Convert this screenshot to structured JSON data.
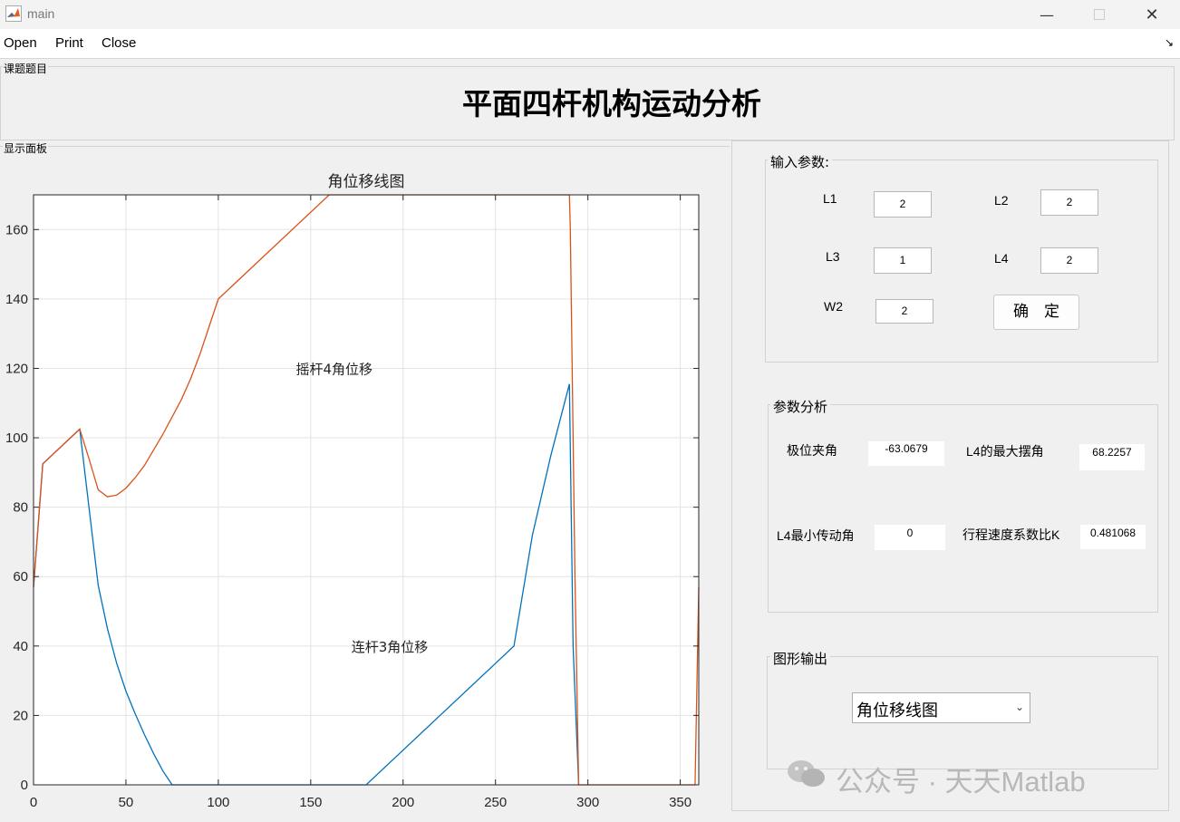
{
  "window": {
    "title": "main"
  },
  "menu": {
    "items": [
      "Open",
      "Print",
      "Close"
    ]
  },
  "title_panel": {
    "label": "课题题目",
    "heading": "平面四杆机构运动分析"
  },
  "display_panel": {
    "label": "显示面板"
  },
  "input_panel": {
    "label": "输入参数:",
    "fields": [
      {
        "label": "L1",
        "value": "2"
      },
      {
        "label": "L2",
        "value": "2"
      },
      {
        "label": "L3",
        "value": "1"
      },
      {
        "label": "L4",
        "value": "2"
      },
      {
        "label": "W2",
        "value": "2"
      }
    ],
    "confirm_label": "确　定"
  },
  "analysis_panel": {
    "label": "参数分析",
    "items": [
      {
        "label": "极位夹角",
        "value": "-63.0679"
      },
      {
        "label": "L4的最大摆角",
        "value": "68.2257"
      },
      {
        "label": "L4最小传动角",
        "value": "0"
      },
      {
        "label": "行程速度系数比K",
        "value": "0.481068"
      }
    ]
  },
  "output_panel": {
    "label": "图形输出",
    "select_value": "角位移线图"
  },
  "watermark": "公众号 · 天天Matlab",
  "chart_data": {
    "type": "line",
    "title": "角位移线图",
    "xlim": [
      0,
      360
    ],
    "ylim": [
      0,
      170
    ],
    "xticks": [
      0,
      50,
      100,
      150,
      200,
      250,
      300,
      350
    ],
    "yticks": [
      0,
      20,
      40,
      60,
      80,
      100,
      120,
      140,
      160
    ],
    "grid": true,
    "annotations": [
      {
        "text": "摇杆4角位移",
        "x": 142,
        "y": 120
      },
      {
        "text": "连杆3角位移",
        "x": 172,
        "y": 40
      }
    ],
    "series": [
      {
        "color": "#0072bd",
        "x": [
          0,
          5,
          25,
          30,
          35,
          40,
          45,
          50,
          55,
          60,
          65,
          70,
          75,
          180,
          260,
          270,
          280,
          290,
          292,
          295
        ],
        "y": [
          57,
          92.5,
          102.5,
          80,
          57.5,
          45,
          35,
          27,
          20.5,
          14.5,
          9,
          4,
          0,
          0,
          40,
          72,
          95,
          115.5,
          40,
          0
        ]
      },
      {
        "color": "#d95319",
        "x": [
          0,
          5,
          25,
          30,
          35,
          40,
          45,
          50,
          55,
          60,
          65,
          70,
          75,
          80,
          85,
          90,
          95,
          100,
          160,
          290,
          290.5,
          293,
          295,
          358,
          360
        ],
        "y": [
          57,
          92.5,
          102.5,
          94,
          85,
          83,
          83.5,
          85.5,
          88.5,
          92,
          96.5,
          101,
          106,
          111,
          117,
          124,
          132,
          140,
          170,
          170,
          160,
          60,
          0,
          0,
          57
        ]
      }
    ]
  }
}
